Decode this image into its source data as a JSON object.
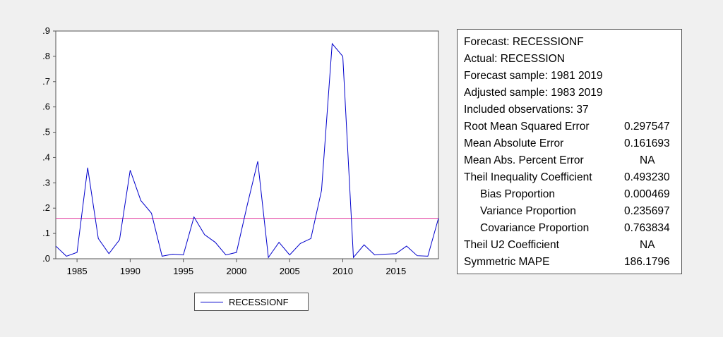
{
  "chart_data": {
    "type": "line",
    "xlabel": "",
    "ylabel": "",
    "xlim": [
      1983,
      2019
    ],
    "ylim": [
      0,
      0.9
    ],
    "x_ticks": [
      1985,
      1990,
      1995,
      2000,
      2005,
      2010,
      2015
    ],
    "x_tick_labels": [
      "1985",
      "1990",
      "1995",
      "2000",
      "2005",
      "2010",
      "2015"
    ],
    "y_ticks": [
      0,
      0.1,
      0.2,
      0.3,
      0.4,
      0.5,
      0.6,
      0.7,
      0.8,
      0.9
    ],
    "y_tick_labels": [
      ".0",
      ".1",
      ".2",
      ".3",
      ".4",
      ".5",
      ".6",
      ".7",
      ".8",
      ".9"
    ],
    "grid": false,
    "legend_position": "bottom-center",
    "series": [
      {
        "name": "RECESSIONF",
        "color": "#0000cc",
        "x": [
          1983,
          1984,
          1985,
          1986,
          1987,
          1988,
          1989,
          1990,
          1991,
          1992,
          1993,
          1994,
          1995,
          1996,
          1997,
          1998,
          1999,
          2000,
          2001,
          2002,
          2003,
          2004,
          2005,
          2006,
          2007,
          2008,
          2009,
          2010,
          2011,
          2012,
          2013,
          2014,
          2015,
          2016,
          2017,
          2018,
          2019
        ],
        "values": [
          0.05,
          0.01,
          0.025,
          0.36,
          0.08,
          0.02,
          0.075,
          0.35,
          0.23,
          0.18,
          0.01,
          0.018,
          0.015,
          0.165,
          0.095,
          0.065,
          0.015,
          0.025,
          0.21,
          0.385,
          0.005,
          0.065,
          0.015,
          0.06,
          0.08,
          0.27,
          0.85,
          0.8,
          0.005,
          0.055,
          0.015,
          0.018,
          0.02,
          0.05,
          0.012,
          0.01,
          0.16
        ]
      }
    ],
    "reference_lines": [
      {
        "value": 0.16,
        "color": "#e0309a"
      }
    ]
  },
  "stats": {
    "header_lines": [
      "Forecast: RECESSIONF",
      "Actual: RECESSION",
      "Forecast sample: 1981 2019",
      "Adjusted sample: 1983 2019",
      "Included observations: 37"
    ],
    "rows": [
      {
        "label": "Root Mean Squared Error",
        "value": "0.297547",
        "indent": false
      },
      {
        "label": "Mean Absolute Error",
        "value": "0.161693",
        "indent": false
      },
      {
        "label": "Mean Abs. Percent Error",
        "value": "NA",
        "indent": false
      },
      {
        "label": "Theil Inequality Coefficient",
        "value": "0.493230",
        "indent": false
      },
      {
        "label": "Bias Proportion",
        "value": "0.000469",
        "indent": true
      },
      {
        "label": "Variance Proportion",
        "value": "0.235697",
        "indent": true
      },
      {
        "label": "Covariance Proportion",
        "value": "0.763834",
        "indent": true
      },
      {
        "label": "Theil U2 Coefficient",
        "value": "NA",
        "indent": false
      },
      {
        "label": "Symmetric MAPE",
        "value": "186.1796",
        "indent": false
      }
    ]
  }
}
